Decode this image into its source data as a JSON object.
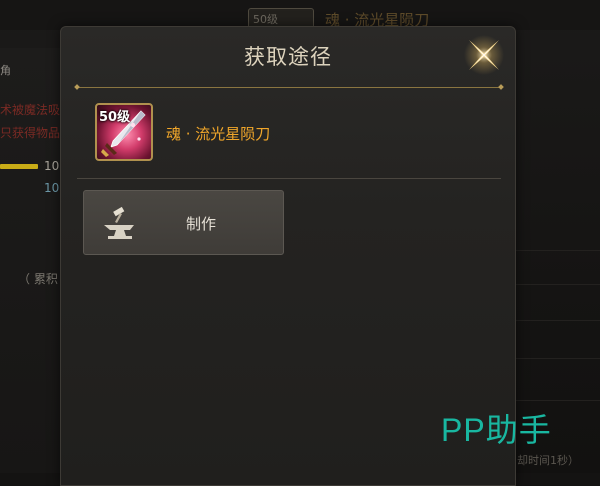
{
  "dialog": {
    "title": "获取途径",
    "close_icon": "close-x-icon",
    "accent_color": "#b89c58"
  },
  "item": {
    "level_badge": "50级",
    "name": "魂 · 流光星陨刀",
    "name_color": "#f0a62a",
    "icon": "sword-icon"
  },
  "sources": [
    {
      "label": "制作",
      "icon": "anvil-hammer-icon"
    }
  ],
  "background": {
    "number_1": "10",
    "number_2": "10",
    "paren_text": "（ 累积",
    "badge_text": "50级",
    "title_text": "魂 · 流光星陨刀",
    "footer_text": "却时间1秒）"
  },
  "watermark": {
    "text": "PP助手",
    "color": "#19b7a1"
  }
}
